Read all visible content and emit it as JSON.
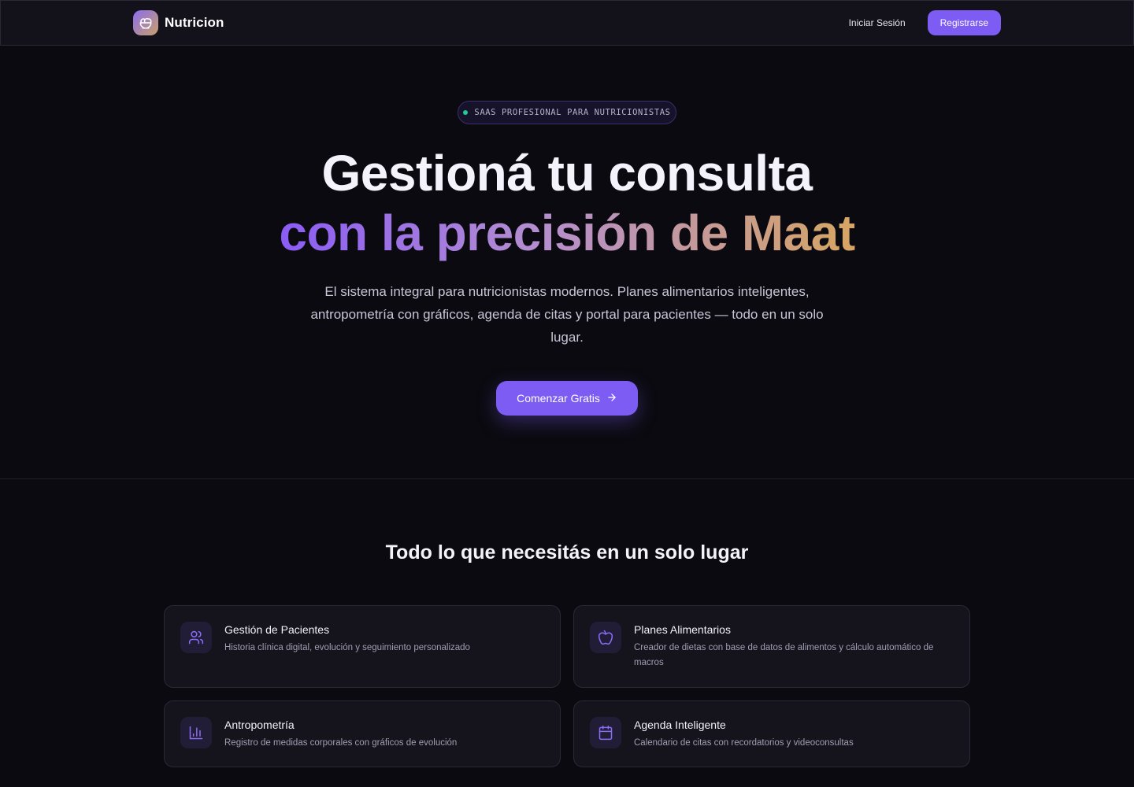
{
  "nav": {
    "brand": "Nutricion",
    "login_label": "Iniciar Sesión",
    "register_label": "Registrarse"
  },
  "hero": {
    "badge": "SAAS PROFESIONAL PARA NUTRICIONISTAS",
    "title_line1": "Gestioná tu consulta",
    "title_line2": "con la precisión de Maat",
    "description": "El sistema integral para nutricionistas modernos. Planes alimentarios inteligentes, antropometría con gráficos, agenda de citas y portal para pacientes — todo en un solo lugar.",
    "cta_label": "Comenzar Gratis"
  },
  "features": {
    "heading": "Todo lo que necesitás en un solo lugar",
    "items": [
      {
        "title": "Gestión de Pacientes",
        "description": "Historia clínica digital, evolución y seguimiento personalizado",
        "icon": "users-icon"
      },
      {
        "title": "Planes Alimentarios",
        "description": "Creador de dietas con base de datos de alimentos y cálculo automático de macros",
        "icon": "apple-icon"
      },
      {
        "title": "Antropometría",
        "description": "Registro de medidas corporales con gráficos de evolución",
        "icon": "bar-chart-icon"
      },
      {
        "title": "Agenda Inteligente",
        "description": "Calendario de citas con recordatorios y videoconsultas",
        "icon": "calendar-icon"
      }
    ]
  },
  "colors": {
    "background": "#0b0a10",
    "accent": "#7c5cf2",
    "gold": "#d6a563",
    "badge_dot": "#22c79b"
  }
}
